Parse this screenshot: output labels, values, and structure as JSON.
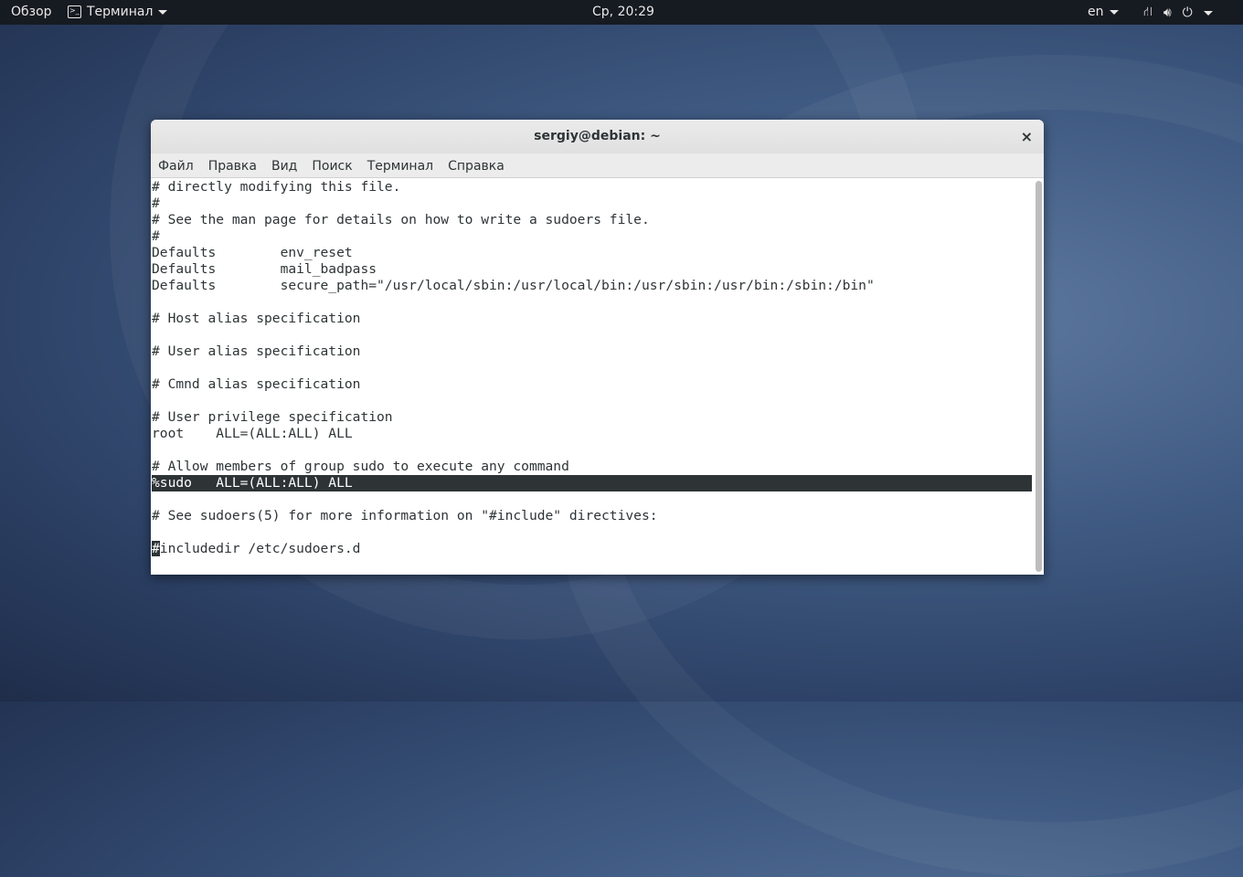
{
  "topbar": {
    "overview": "Обзор",
    "app": "Терминал",
    "clock": "Ср, 20:29",
    "lang": "en"
  },
  "window": {
    "title": "sergiy@debian: ~",
    "close": "×"
  },
  "menu": [
    "Файл",
    "Правка",
    "Вид",
    "Поиск",
    "Терминал",
    "Справка"
  ],
  "terminal": {
    "lines": [
      "# directly modifying this file.",
      "#",
      "# See the man page for details on how to write a sudoers file.",
      "#",
      "Defaults        env_reset",
      "Defaults        mail_badpass",
      "Defaults        secure_path=\"/usr/local/sbin:/usr/local/bin:/usr/sbin:/usr/bin:/sbin:/bin\"",
      "",
      "# Host alias specification",
      "",
      "# User alias specification",
      "",
      "# Cmnd alias specification",
      "",
      "# User privilege specification",
      "root    ALL=(ALL:ALL) ALL",
      "",
      "# Allow members of group sudo to execute any command",
      "%sudo   ALL=(ALL:ALL) ALL",
      "",
      "# See sudoers(5) for more information on \"#include\" directives:",
      ""
    ],
    "cursor_char": "#",
    "last_line_rest": "includedir /etc/sudoers.d"
  }
}
